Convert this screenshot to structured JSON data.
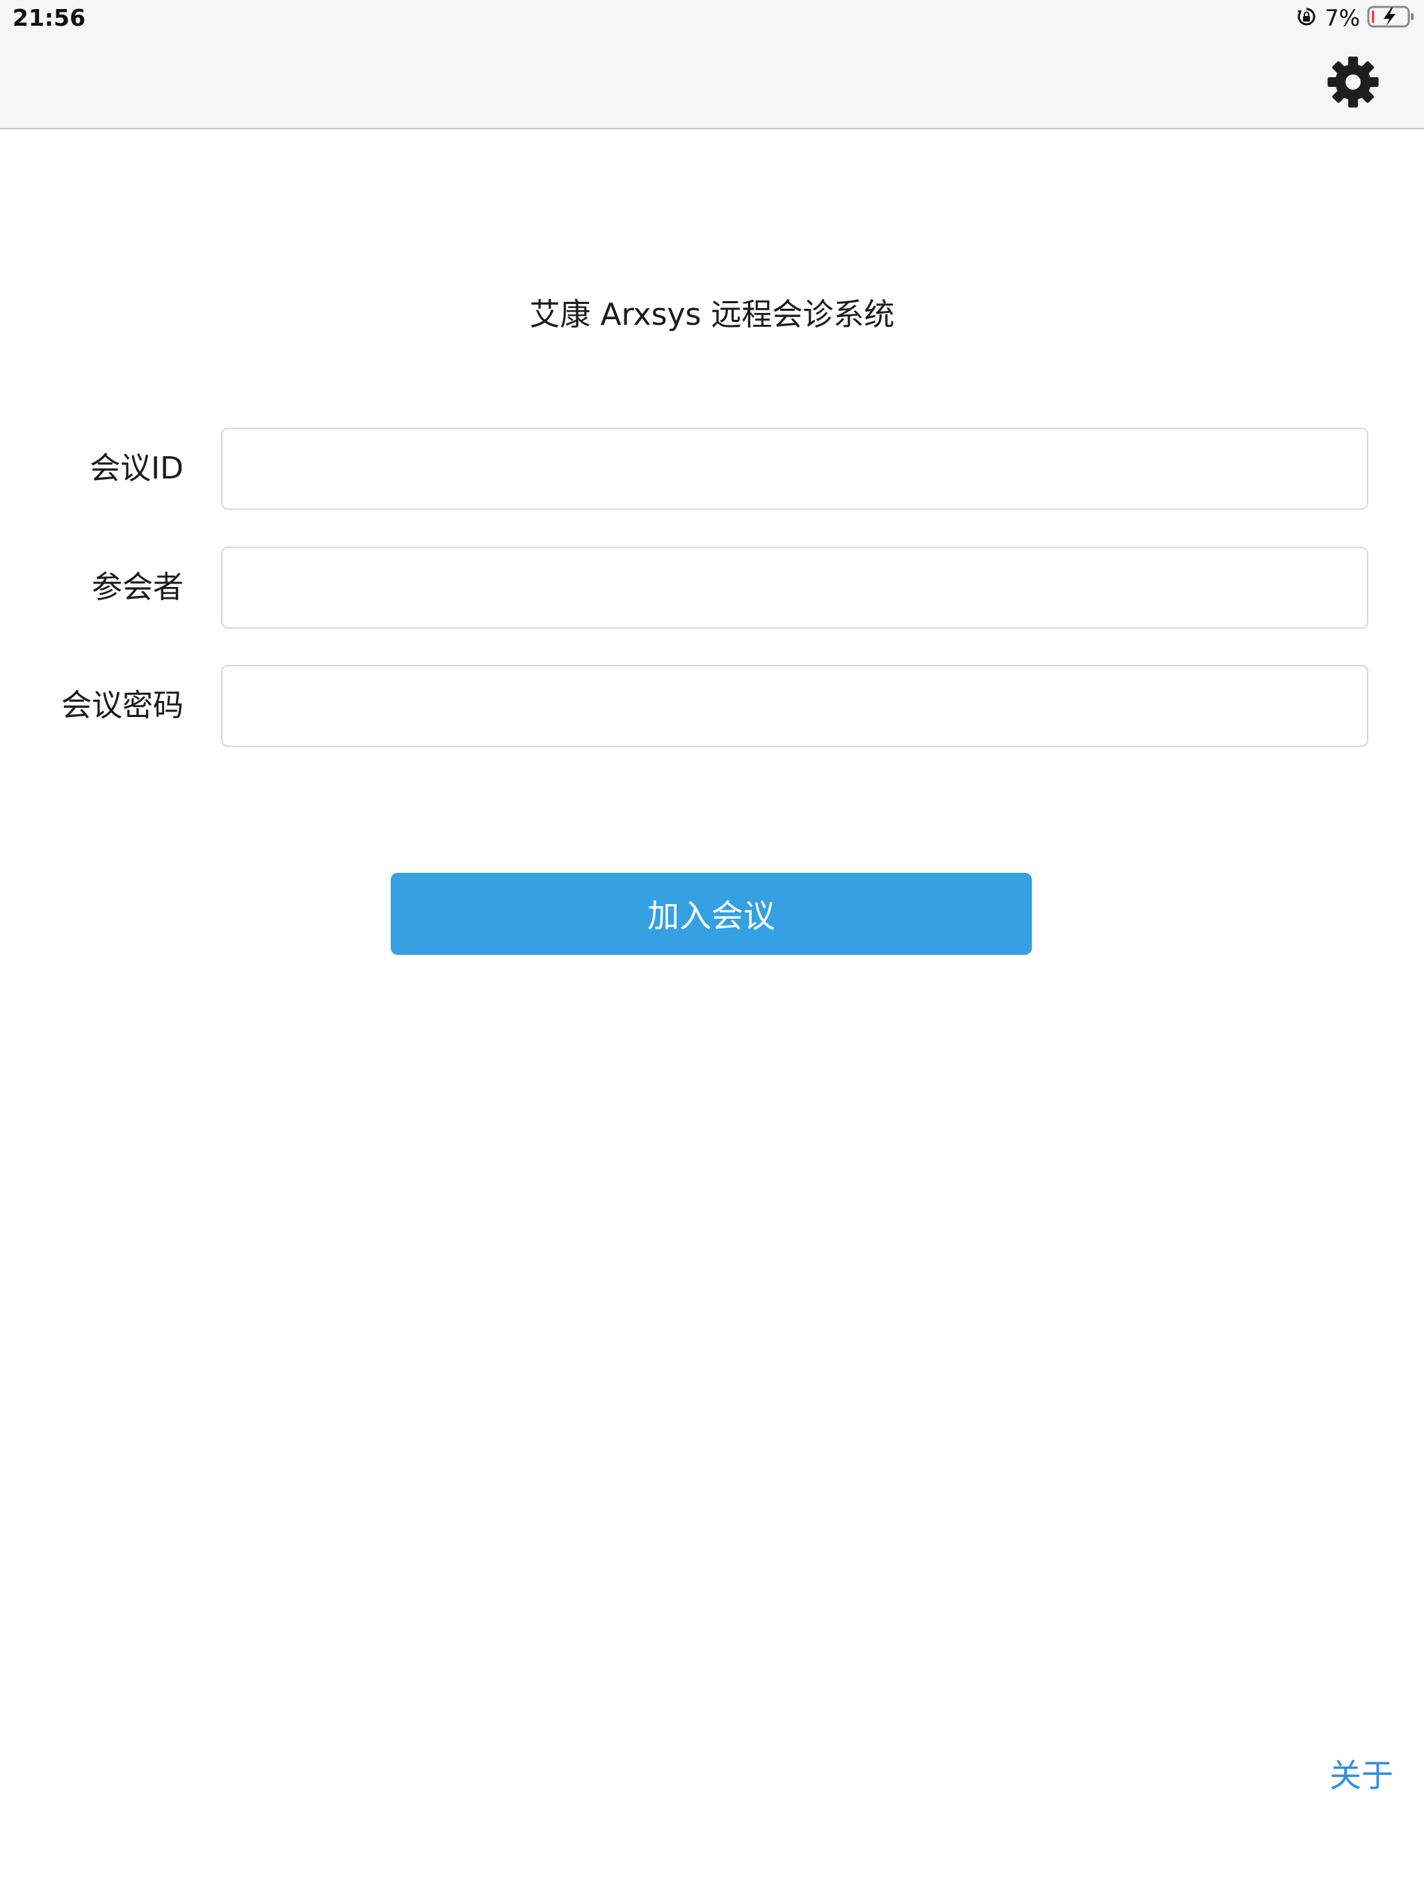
{
  "status_bar": {
    "time": "21:56",
    "battery_percent": "7%",
    "battery_level": 0.07,
    "icons": [
      "rotation-lock-icon",
      "battery-charging-icon"
    ]
  },
  "nav_bar": {
    "settings_icon": "gear-icon"
  },
  "app": {
    "title": "艾康 Arxsys 远程会诊系统"
  },
  "form": {
    "meeting_id": {
      "label": "会议ID",
      "value": ""
    },
    "participant": {
      "label": "参会者",
      "value": ""
    },
    "password": {
      "label": "会议密码",
      "value": ""
    }
  },
  "actions": {
    "join_label": "加入会议"
  },
  "footer": {
    "about_label": "关于"
  },
  "colors": {
    "accent": "#35a0e2",
    "link": "#2f8fdf",
    "battery_low": "#ff3b30"
  }
}
